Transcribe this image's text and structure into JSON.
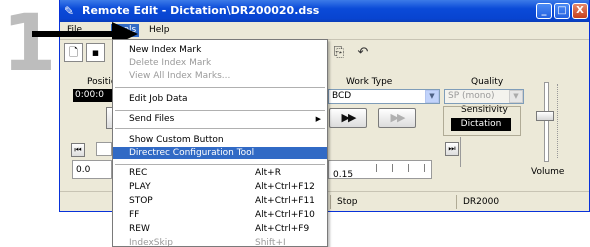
{
  "step": {
    "number": "1"
  },
  "window": {
    "title": "Remote Edit - Dictation\\DR200020.dss",
    "controls": {
      "minimize": "_",
      "maximize": "□",
      "close": "X"
    }
  },
  "menubar": {
    "items": [
      "File",
      "Tools",
      "Help"
    ],
    "active": "Tools"
  },
  "main": {
    "position_label": "Positio",
    "position_value": "0:00:0",
    "work_type_label": "Work Type",
    "work_type_value": "BCD",
    "quality_label": "Quality",
    "quality_value": "SP (mono)",
    "sensitivity_label": "Sensitivity",
    "sensitivity_value": "Dictation",
    "scale_left": "0.0",
    "scale_mid": "0.15",
    "volume_label": "Volume",
    "play_button": "▶▶",
    "fast_button": "▶▶"
  },
  "status": {
    "stop": "Stop",
    "model": "DR2000"
  },
  "tools_menu": {
    "groups": [
      [
        {
          "label": "New Index Mark",
          "shortcut": "",
          "disabled": false
        },
        {
          "label": "Delete Index Mark",
          "shortcut": "",
          "disabled": true
        },
        {
          "label": "View All Index Marks...",
          "shortcut": "",
          "disabled": true
        }
      ],
      [
        {
          "label": "Edit Job Data",
          "shortcut": "",
          "disabled": false
        }
      ],
      [
        {
          "label": "Send Files",
          "shortcut": "",
          "disabled": false,
          "submenu": true
        }
      ],
      [
        {
          "label": "Show Custom Button",
          "shortcut": "",
          "disabled": false
        },
        {
          "label": "Directrec Configuration Tool",
          "shortcut": "",
          "disabled": false,
          "highlight": true
        }
      ],
      [
        {
          "label": "REC",
          "shortcut": "Alt+R",
          "disabled": false
        },
        {
          "label": "PLAY",
          "shortcut": "Alt+Ctrl+F12",
          "disabled": false
        },
        {
          "label": "STOP",
          "shortcut": "Alt+Ctrl+F11",
          "disabled": false
        },
        {
          "label": "FF",
          "shortcut": "Alt+Ctrl+F10",
          "disabled": false
        },
        {
          "label": "REW",
          "shortcut": "Alt+Ctrl+F9",
          "disabled": false
        },
        {
          "label": "IndexSkip",
          "shortcut": "Shift+I",
          "disabled": true
        }
      ]
    ]
  },
  "colors": {
    "titlebar": "#0a4ad8",
    "highlight": "#316ac5",
    "step_number": "#bdbdbd"
  },
  "icons": [
    "pencil-icon",
    "new-file-icon",
    "save-icon",
    "transfer-icon",
    "undo-icon"
  ]
}
